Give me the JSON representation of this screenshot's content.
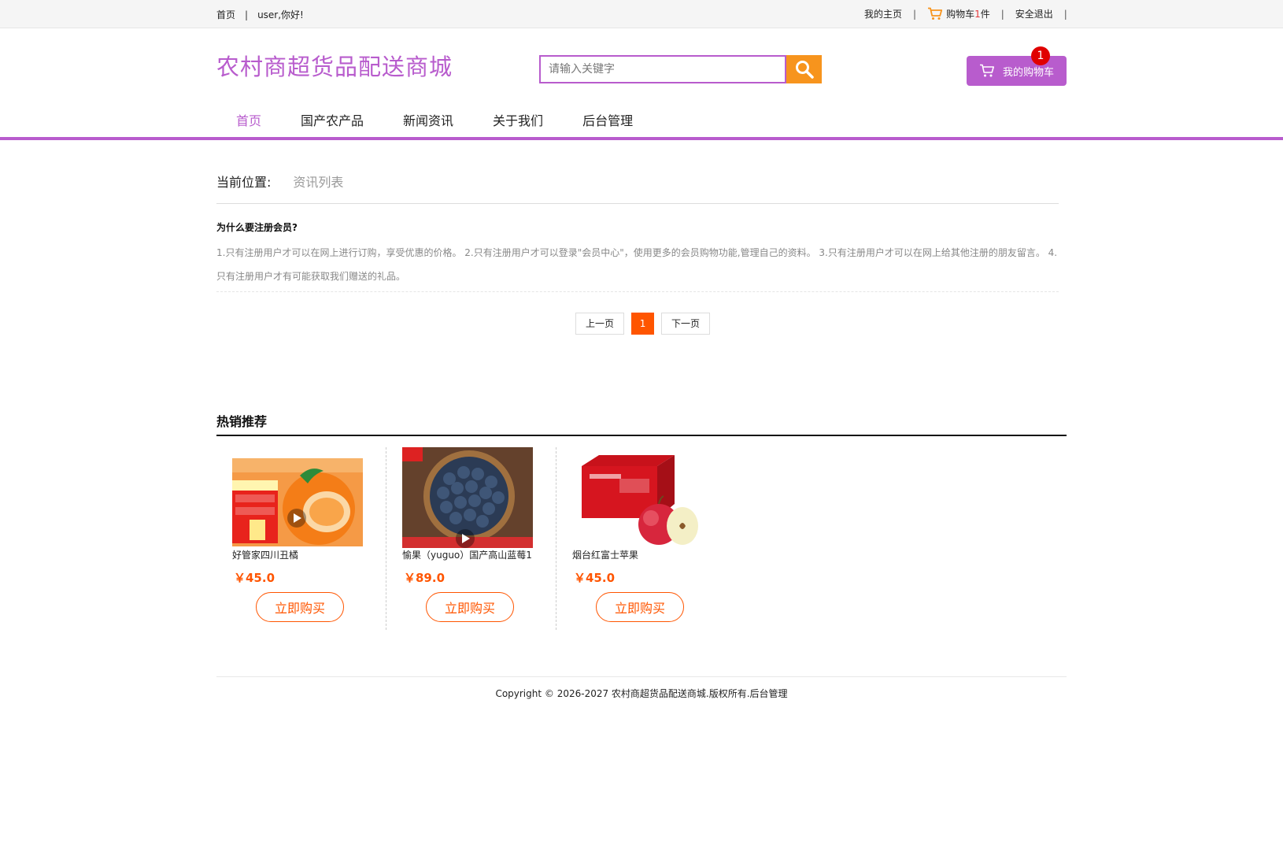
{
  "topbar": {
    "home": "首页",
    "separator": "|",
    "greeting": "user,你好!",
    "my_home": "我的主页",
    "cart_label": "购物车",
    "cart_count": "1",
    "cart_unit": "件",
    "logout": "安全退出"
  },
  "header": {
    "logo": "农村商超货品配送商城",
    "search_placeholder": "请输入关键字",
    "my_cart": "我的购物车",
    "cart_badge": "1"
  },
  "nav": {
    "items": [
      "首页",
      "国产农产品",
      "新闻资讯",
      "关于我们",
      "后台管理"
    ]
  },
  "breadcrumb": {
    "label": "当前位置:",
    "current": "资讯列表"
  },
  "article": {
    "title": "为什么要注册会员?",
    "body": "1.只有注册用户才可以在网上进行订购，享受优惠的价格。 2.只有注册用户才可以登录\"会员中心\"，使用更多的会员购物功能,管理自己的资料。 3.只有注册用户才可以在网上给其他注册的朋友留言。 4.只有注册用户才有可能获取我们赠送的礼品。"
  },
  "pager": {
    "prev": "上一页",
    "current": "1",
    "next": "下一页"
  },
  "hot": {
    "title": "热销推荐",
    "buy_label": "立即购买",
    "products": [
      {
        "name": "好管家四川丑橘",
        "price": "￥45.0"
      },
      {
        "name": "愉果（yuguo）国产高山蓝莓1",
        "price": "￥89.0"
      },
      {
        "name": "烟台红富士苹果",
        "price": "￥45.0"
      }
    ]
  },
  "footer": {
    "copyright": "Copyright © 2026-2027 农村商超货品配送商城.版权所有.后台管理"
  },
  "colors": {
    "accent": "#b85ccd",
    "price": "#ff5500",
    "search_button": "#f7941d"
  }
}
